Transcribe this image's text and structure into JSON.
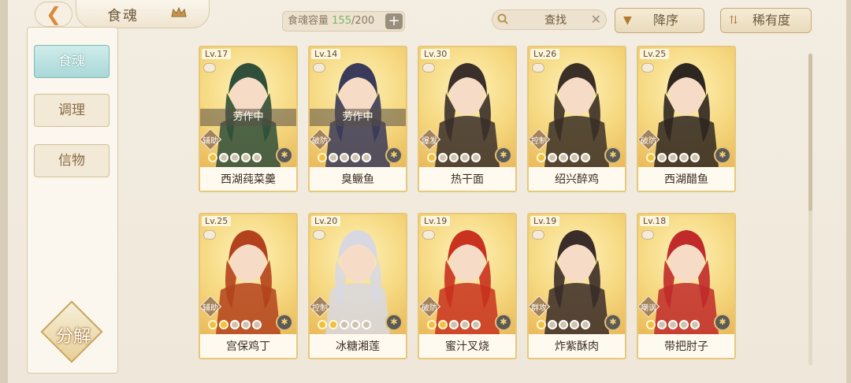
{
  "header": {
    "title": "食魂",
    "capacity_label": "食魂容量",
    "capacity_current": "155",
    "capacity_max": "/200",
    "capacity_add": "+",
    "search_placeholder": "查找",
    "sort_order_label": "降序",
    "sort_field_label": "稀有度",
    "icons": [
      "back-icon",
      "crown-icon",
      "add-icon",
      "search-icon",
      "clear-icon",
      "sort-order-icon",
      "sort-field-icon"
    ]
  },
  "sidebar": {
    "tabs": [
      {
        "label": "食魂",
        "active": true
      },
      {
        "label": "调理",
        "active": false
      },
      {
        "label": "信物",
        "active": false
      }
    ],
    "decompose_label": "分解"
  },
  "cards": [
    {
      "level": "Lv.17",
      "name": "西湖莼菜羹",
      "role": "辅助",
      "status": "劳作中",
      "stars": 5,
      "filled": 1,
      "hue": "#2f4f3a"
    },
    {
      "level": "Lv.14",
      "name": "臭鳜鱼",
      "role": "破防",
      "status": "劳作中",
      "stars": 5,
      "filled": 1,
      "hue": "#3a3a5a"
    },
    {
      "level": "Lv.30",
      "name": "热干面",
      "role": "爆发",
      "status": "",
      "stars": 5,
      "filled": 1,
      "hue": "#3a2f2a"
    },
    {
      "level": "Lv.26",
      "name": "绍兴醉鸡",
      "role": "控制",
      "status": "",
      "stars": 5,
      "filled": 1,
      "hue": "#3a2f26"
    },
    {
      "level": "Lv.25",
      "name": "西湖醋鱼",
      "role": "破防",
      "status": "",
      "stars": 5,
      "filled": 1,
      "hue": "#2e2620"
    },
    {
      "level": "Lv.25",
      "name": "宫保鸡丁",
      "role": "辅助",
      "status": "",
      "stars": 5,
      "filled": 2,
      "hue": "#b3421c"
    },
    {
      "level": "Lv.20",
      "name": "冰糖湘莲",
      "role": "控制",
      "status": "",
      "stars": 5,
      "filled": 2,
      "hue": "#d8d8e2"
    },
    {
      "level": "Lv.19",
      "name": "蜜汁叉烧",
      "role": "破防",
      "status": "",
      "stars": 5,
      "filled": 2,
      "hue": "#c8321e"
    },
    {
      "level": "Lv.19",
      "name": "炸紫酥肉",
      "role": "群攻",
      "status": "",
      "stars": 5,
      "filled": 1,
      "hue": "#3a2c28"
    },
    {
      "level": "Lv.18",
      "name": "带把肘子",
      "role": "嘲讽",
      "status": "",
      "stars": 5,
      "filled": 1,
      "hue": "#c02a2a"
    }
  ],
  "colors": {
    "accent_teal": "#a9d8d8",
    "card_border": "#e7c77a",
    "star_on": "#f0c040"
  }
}
